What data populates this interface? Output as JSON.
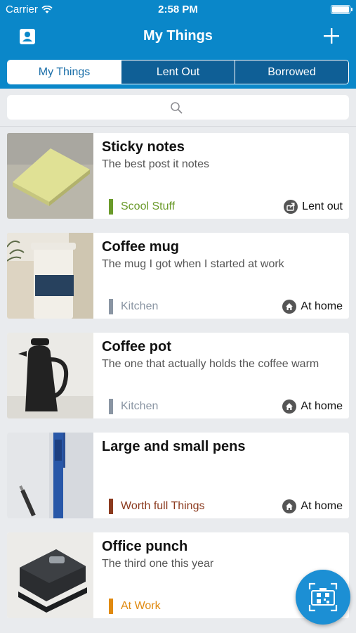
{
  "status_bar": {
    "carrier": "Carrier",
    "time": "2:58 PM"
  },
  "nav": {
    "title": "My Things",
    "left_icon": "contact-card-icon",
    "right_icon": "plus-icon"
  },
  "tabs": [
    {
      "label": "My Things",
      "active": true
    },
    {
      "label": "Lent Out",
      "active": false
    },
    {
      "label": "Borrowed",
      "active": false
    }
  ],
  "search": {
    "icon": "search-icon"
  },
  "items": [
    {
      "name": "Sticky notes",
      "description": "The best post it notes",
      "category": "Scool Stuff",
      "category_color": "#6a9a2a",
      "status": "Lent out",
      "status_icon": "share-icon"
    },
    {
      "name": "Coffee mug",
      "description": "The mug I got when I started at work",
      "category": "Kitchen",
      "category_color": "#8a95a3",
      "status": "At home",
      "status_icon": "home-icon"
    },
    {
      "name": "Coffee pot",
      "description": "The one that actually holds the coffee warm",
      "category": "Kitchen",
      "category_color": "#8a95a3",
      "status": "At home",
      "status_icon": "home-icon"
    },
    {
      "name": "Large and small pens",
      "description": "",
      "category": "Worth full Things",
      "category_color": "#8b3a1e",
      "status": "At home",
      "status_icon": "home-icon"
    },
    {
      "name": "Office punch",
      "description": "The third one this year",
      "category": "At Work",
      "category_color": "#e08a10",
      "status": "",
      "status_icon": "home-icon"
    }
  ],
  "fab": {
    "icon": "qr-scan-icon"
  },
  "colors": {
    "primary": "#0a87c9",
    "tab_inactive": "#0f5f96",
    "background": "#e9ebee"
  }
}
